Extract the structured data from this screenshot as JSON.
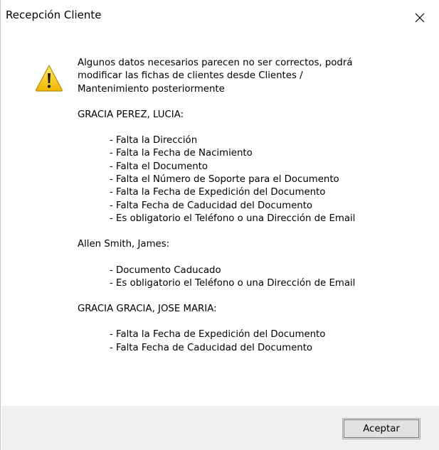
{
  "window": {
    "title": "Recepción Cliente",
    "close_icon": "close-x-icon"
  },
  "message": {
    "icon": "warning-icon",
    "intro_lines": [
      "Algunos datos necesarios parecen no ser correctos, podrá",
      "modificar las fichas de clientes desde Clientes /",
      "Mantenimiento posteriormente"
    ],
    "clients": [
      {
        "name": "GRACIA PEREZ, LUCIA:",
        "issues": [
          "- Falta la Dirección",
          "- Falta la Fecha de Nacimiento",
          "- Falta el Documento",
          "- Falta el Número de Soporte para el Documento",
          "- Falta la Fecha de Expedición del Documento",
          "- Falta Fecha de Caducidad del Documento",
          "- Es obligatorio el Teléfono o una Dirección de Email"
        ]
      },
      {
        "name": "Allen Smith, James:",
        "issues": [
          "- Documento Caducado",
          "- Es obligatorio el Teléfono o una Dirección de Email"
        ]
      },
      {
        "name": "GRACIA GRACIA, JOSE MARIA:",
        "issues": [
          "- Falta la Fecha de Expedición del Documento",
          "- Falta Fecha de Caducidad del Documento"
        ]
      }
    ]
  },
  "footer": {
    "accept_label": "Aceptar"
  },
  "colors": {
    "footer_bg": "#f0f0f0",
    "button_bg": "#e1e1e1",
    "warning_yellow": "#f5c400"
  }
}
